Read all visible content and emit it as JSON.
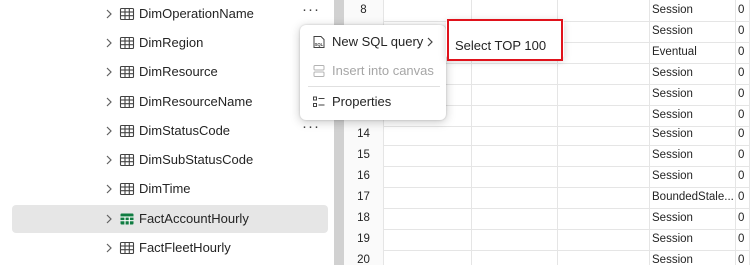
{
  "tree": {
    "items": [
      {
        "label": "DimOperationName",
        "has_more": true
      },
      {
        "label": "DimRegion"
      },
      {
        "label": "DimResource"
      },
      {
        "label": "DimResourceName"
      },
      {
        "label": "DimStatusCode",
        "has_more": true
      },
      {
        "label": "DimSubStatusCode"
      },
      {
        "label": "DimTime"
      },
      {
        "label": "FactAccountHourly",
        "selected": true,
        "icon_color": "#107c41"
      },
      {
        "label": "FactFleetHourly"
      }
    ],
    "more_label": "···"
  },
  "context_menu": {
    "items": [
      {
        "label": "New SQL query",
        "icon": "sql-icon",
        "has_submenu": true
      },
      {
        "label": "Insert into canvas",
        "icon": "canvas-icon",
        "disabled": true
      },
      {
        "label": "Properties",
        "icon": "properties-icon"
      }
    ],
    "submenu": {
      "items": [
        {
          "label": "Select TOP 100"
        }
      ]
    }
  },
  "grid": {
    "rows": [
      {
        "num": "8",
        "col4": "Session",
        "col5": "0"
      },
      {
        "num": "",
        "col4": "Session",
        "col5": "0"
      },
      {
        "num": "",
        "col4": "Eventual",
        "col5": "0"
      },
      {
        "num": "",
        "col4": "Session",
        "col5": "0"
      },
      {
        "num": "",
        "col4": "Session",
        "col5": "0"
      },
      {
        "num": "",
        "col4": "Session",
        "col5": "0"
      },
      {
        "num": "14",
        "col4": "Session",
        "col5": "0"
      },
      {
        "num": "15",
        "col4": "Session",
        "col5": "0"
      },
      {
        "num": "16",
        "col4": "Session",
        "col5": "0"
      },
      {
        "num": "17",
        "col4": "BoundedStale...",
        "col5": "0"
      },
      {
        "num": "18",
        "col4": "Session",
        "col5": "0"
      },
      {
        "num": "19",
        "col4": "Session",
        "col5": "0"
      },
      {
        "num": "20",
        "col4": "Session",
        "col5": "0"
      }
    ]
  },
  "colors": {
    "highlight": "#e0121b",
    "selected_row": "#e6e6e6",
    "splitter": "#d1d1d1"
  }
}
